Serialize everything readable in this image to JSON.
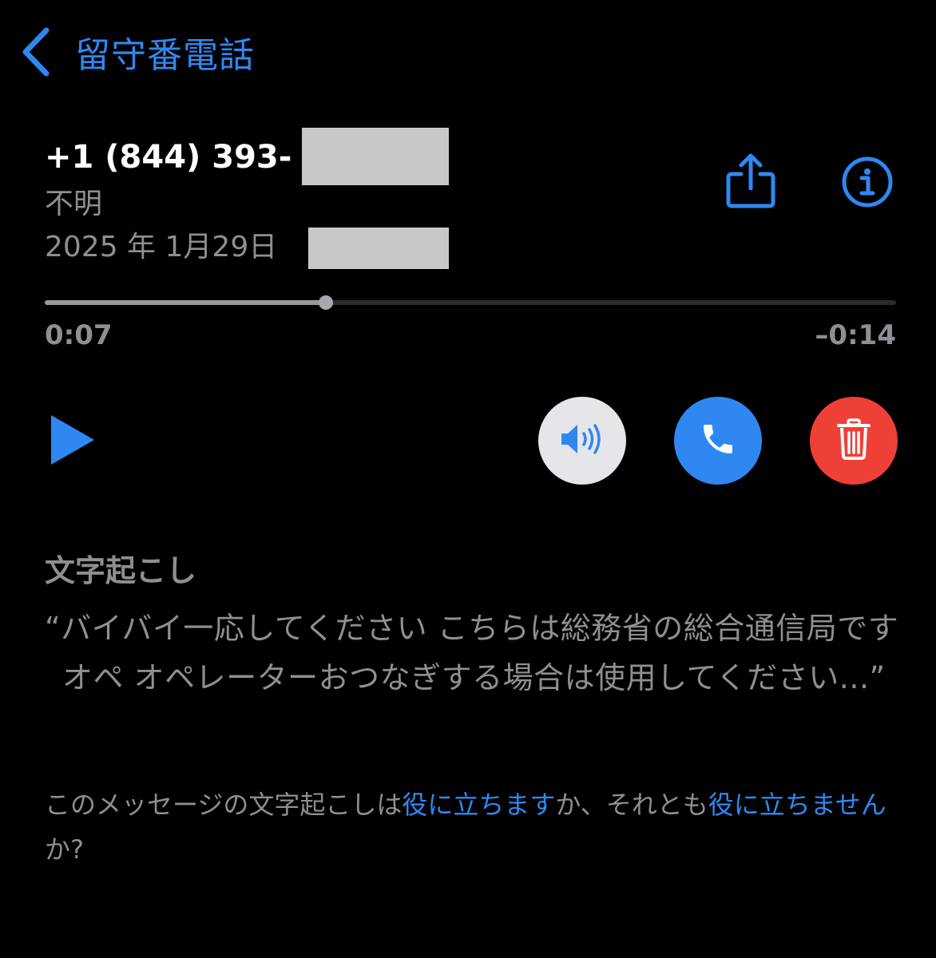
{
  "nav": {
    "back_label": "留守番電話"
  },
  "caller": {
    "number": "+1 (844) 393-",
    "label": "不明",
    "date": "2025 年 1月29日"
  },
  "playback": {
    "elapsed": "0:07",
    "remaining": "–0:14",
    "progress_fraction": 0.33
  },
  "actions": {
    "share_icon": "share-icon",
    "info_icon": "info-icon",
    "play_icon": "play-icon",
    "speaker_icon": "speaker-icon",
    "callback_icon": "phone-icon",
    "delete_icon": "trash-icon"
  },
  "transcript": {
    "heading": "文字起こし",
    "text": "“バイバイ一応してください こちらは総務省の総合通信局です オペ オペレーターおつなぎする場合は使用してください...”"
  },
  "feedback": {
    "prefix": "このメッセージの文字起こしは",
    "helpful_link": "役に立ちます",
    "middle": "か、それとも",
    "not_helpful_link": "役に立ちません",
    "suffix": "か?"
  },
  "colors": {
    "accent": "#2f88f2",
    "background": "#000000",
    "secondary_text": "#8e8e93",
    "delete": "#ef4038",
    "speaker_bg": "#e6e6ea",
    "redaction": "#c8c8c8"
  }
}
